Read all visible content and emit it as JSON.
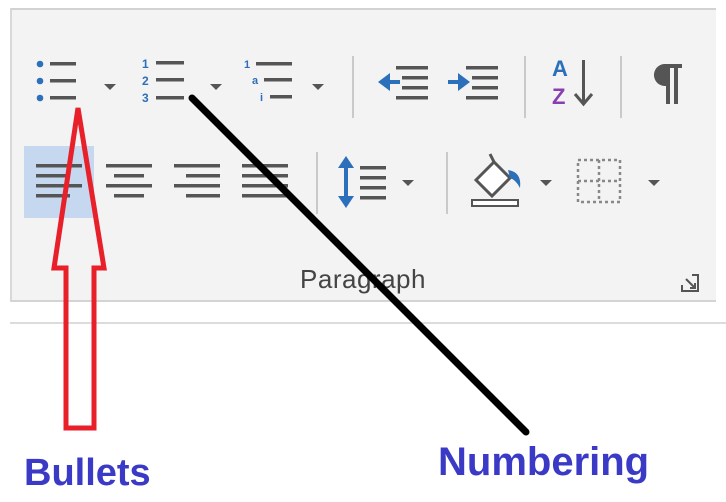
{
  "ribbon": {
    "group_label": "Paragraph",
    "row1": [
      {
        "name": "bullets-button",
        "icon": "bulleted-list-icon",
        "has_dropdown": true
      },
      {
        "name": "numbering-button",
        "icon": "numbered-list-icon",
        "has_dropdown": true
      },
      {
        "name": "multilevel-list-button",
        "icon": "multilevel-list-icon",
        "has_dropdown": true
      },
      {
        "name": "decrease-indent-button",
        "icon": "decrease-indent-icon"
      },
      {
        "name": "increase-indent-button",
        "icon": "increase-indent-icon"
      },
      {
        "name": "sort-button",
        "icon": "sort-az-icon"
      },
      {
        "name": "show-hide-marks-button",
        "icon": "pilcrow-icon"
      }
    ],
    "row2": [
      {
        "name": "align-left-button",
        "icon": "align-left-icon",
        "selected": true
      },
      {
        "name": "align-center-button",
        "icon": "align-center-icon"
      },
      {
        "name": "align-right-button",
        "icon": "align-right-icon"
      },
      {
        "name": "justify-button",
        "icon": "justify-icon"
      },
      {
        "name": "line-spacing-button",
        "icon": "line-spacing-icon",
        "has_dropdown": true
      },
      {
        "name": "shading-button",
        "icon": "paint-bucket-icon",
        "has_dropdown": true
      },
      {
        "name": "borders-button",
        "icon": "borders-icon",
        "has_dropdown": true
      }
    ],
    "dialog_launcher_icon": "dialog-launcher-icon"
  },
  "annotations": {
    "bullets_label": "Bullets",
    "numbering_label": "Numbering",
    "bullets_arrow_color": "#e8202a",
    "numbering_line_color": "#000000",
    "label_color": "#3a3ac6"
  },
  "colors": {
    "icon_gray": "#555555",
    "icon_blue": "#2c6fbb",
    "selected_bg": "#c5d8ef",
    "panel_bg": "#f3f3f3"
  }
}
